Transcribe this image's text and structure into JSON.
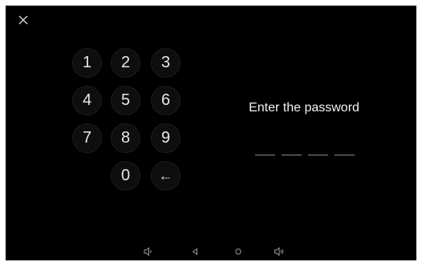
{
  "header": {
    "close_icon": "close-icon"
  },
  "keypad": {
    "keys": [
      {
        "label": "1"
      },
      {
        "label": "2"
      },
      {
        "label": "3"
      },
      {
        "label": "4"
      },
      {
        "label": "5"
      },
      {
        "label": "6"
      },
      {
        "label": "7"
      },
      {
        "label": "8"
      },
      {
        "label": "9"
      },
      {
        "label": "0"
      },
      {
        "label": "←"
      }
    ]
  },
  "password": {
    "prompt": "Enter the password",
    "length": 4,
    "entered": 0
  },
  "navbar": {
    "icons": [
      "volume-down-icon",
      "back-icon",
      "home-icon",
      "volume-up-icon"
    ]
  }
}
